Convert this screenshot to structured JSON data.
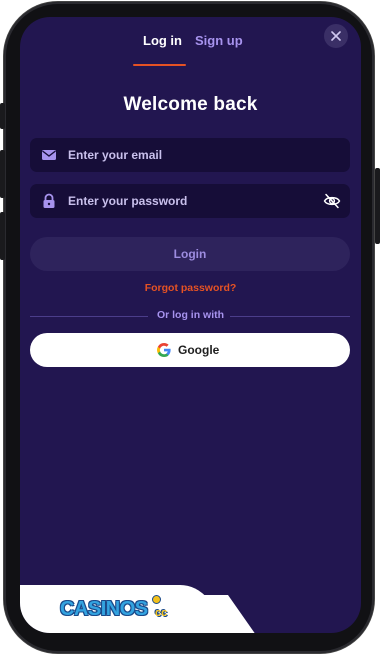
{
  "tabs": {
    "login": "Log in",
    "signup": "Sign up"
  },
  "title": "Welcome back",
  "email": {
    "placeholder": "Enter your email"
  },
  "password": {
    "placeholder": "Enter your password"
  },
  "login_button": "Login",
  "forgot_password": "Forgot password?",
  "divider": "Or log in with",
  "google_button": "Google",
  "logo": {
    "main": "CASINOS",
    "suffix": "cc"
  },
  "colors": {
    "background": "#221650",
    "input_bg": "#160d38",
    "accent_orange": "#e55224",
    "accent_purple": "#a793ee"
  }
}
